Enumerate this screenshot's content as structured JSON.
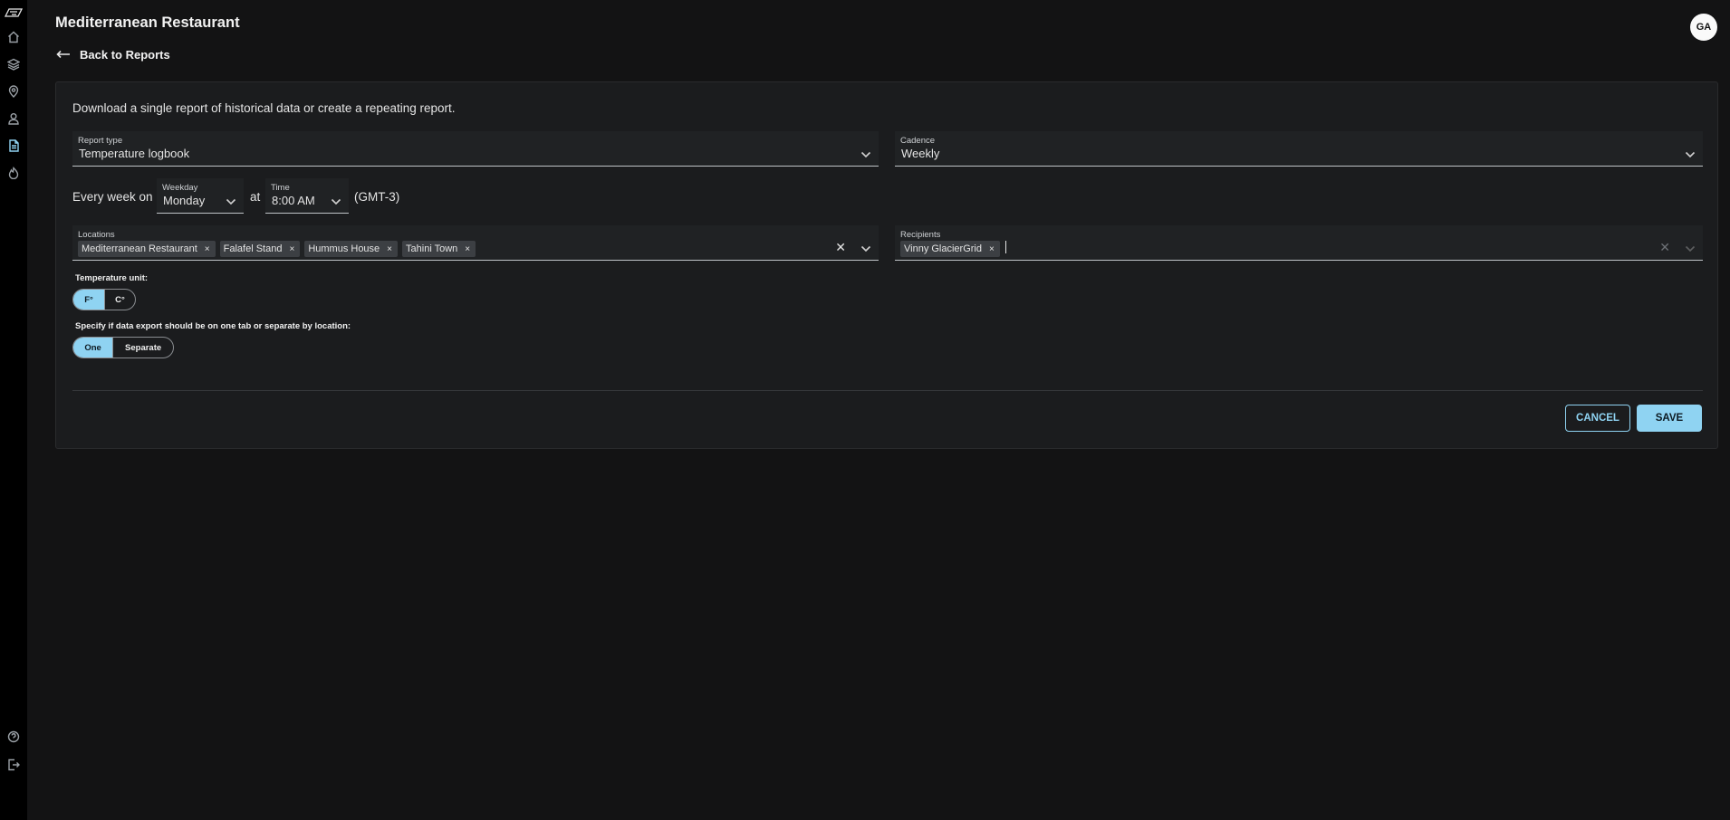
{
  "header": {
    "title": "Mediterranean Restaurant",
    "back_label": "Back to Reports",
    "avatar_initials": "GA"
  },
  "sidebar": {
    "items": [
      {
        "icon": "home-icon"
      },
      {
        "icon": "layers-icon"
      },
      {
        "icon": "location-pin-icon"
      },
      {
        "icon": "user-icon"
      },
      {
        "icon": "report-document-icon",
        "active": true
      },
      {
        "icon": "flame-icon"
      }
    ],
    "bottom": [
      {
        "icon": "help-icon"
      },
      {
        "icon": "logout-icon"
      }
    ]
  },
  "form": {
    "intro": "Download a single report of historical data or create a repeating report.",
    "report_type": {
      "label": "Report type",
      "value": "Temperature logbook"
    },
    "cadence": {
      "label": "Cadence",
      "value": "Weekly"
    },
    "schedule": {
      "prefix": "Every week on",
      "weekday": {
        "label": "Weekday",
        "value": "Monday"
      },
      "at": "at",
      "time": {
        "label": "Time",
        "value": "8:00 AM"
      },
      "timezone": "(GMT-3)"
    },
    "locations": {
      "label": "Locations",
      "chips": [
        "Mediterranean Restaurant",
        "Falafel Stand",
        "Hummus House",
        "Tahini Town"
      ]
    },
    "recipients": {
      "label": "Recipients",
      "chips": [
        "Vinny GlacierGrid"
      ]
    },
    "temperature_unit": {
      "label": "Temperature unit:",
      "options": [
        "F°",
        "C°"
      ],
      "selected": "F°"
    },
    "export_mode": {
      "label": "Specify if data export should be on one tab or separate by location:",
      "options": [
        "One",
        "Separate"
      ],
      "selected": "One"
    },
    "chip_remove_glyph": "×",
    "clear_glyph": "✕"
  },
  "actions": {
    "cancel_label": "CANCEL",
    "save_label": "SAVE"
  },
  "colors": {
    "accent": "#8fd3f2",
    "background": "#131314",
    "card": "#1b1c1e"
  }
}
